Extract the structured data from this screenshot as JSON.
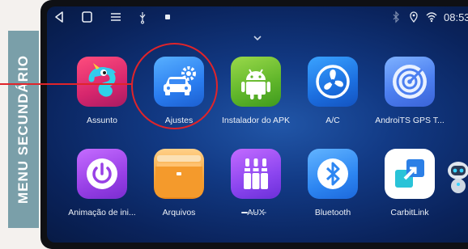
{
  "side_label": "MENU SECUNDÁRIO",
  "status_bar": {
    "time": "08:53",
    "nav_icons": [
      "back-icon",
      "home-icon",
      "menu-icon",
      "usb-icon",
      "notification-icon"
    ],
    "status_icons": [
      "bluetooth-icon",
      "location-icon",
      "wifi-icon"
    ]
  },
  "apps": [
    {
      "label": "Assunto",
      "icon": "chameleon-theme-icon"
    },
    {
      "label": "Ajustes",
      "icon": "car-settings-icon"
    },
    {
      "label": "Instalador do APK",
      "icon": "android-icon"
    },
    {
      "label": "A/C",
      "icon": "fan-icon"
    },
    {
      "label": "AndroiTS GPS T...",
      "icon": "gps-radar-icon"
    },
    {
      "label": "Animação de ini...",
      "icon": "power-icon"
    },
    {
      "label": "Arquivos",
      "icon": "folder-icon"
    },
    {
      "label": "AUX",
      "icon": "aux-jack-icon"
    },
    {
      "label": "Bluetooth",
      "icon": "bluetooth-icon"
    },
    {
      "label": "CarbitLink",
      "icon": "carbitlink-icon"
    }
  ],
  "pager": {
    "pages": 3,
    "current": 1
  },
  "colors": {
    "label_bg": "#7a9fa9",
    "callout": "#e0242a",
    "screen_bg": "#123a85"
  }
}
